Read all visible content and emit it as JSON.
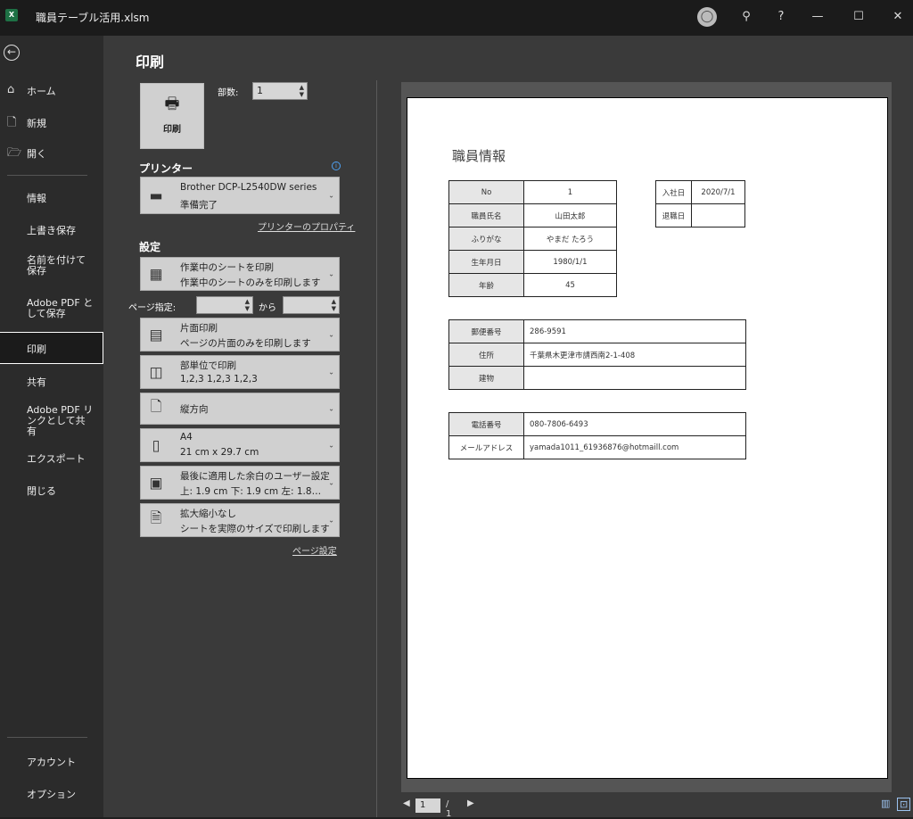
{
  "window": {
    "title": "職員テーブル活用.xlsm",
    "app_icon": "X",
    "buttons": {
      "help": "?",
      "minimize": "—",
      "maximize": "☐",
      "close": "✕"
    }
  },
  "sidebar": {
    "items": [
      {
        "label": "ホーム",
        "icon": "home-icon"
      },
      {
        "label": "新規",
        "icon": "new-document-icon"
      },
      {
        "label": "開く",
        "icon": "open-folder-icon"
      },
      {
        "label": "情報"
      },
      {
        "label": "上書き保存"
      },
      {
        "label": "名前を付けて保存"
      },
      {
        "label": "Adobe PDF として保存"
      },
      {
        "label": "印刷",
        "selected": true
      },
      {
        "label": "共有"
      },
      {
        "label": "Adobe PDF リンクとして共有"
      },
      {
        "label": "エクスポート"
      },
      {
        "label": "閉じる"
      },
      {
        "label": "アカウント"
      },
      {
        "label": "オプション"
      }
    ]
  },
  "print": {
    "heading": "印刷",
    "print_button": "印刷",
    "copies_label": "部数:",
    "copies_value": "1",
    "printer_section": "プリンター",
    "printer_name": "Brother DCP-L2540DW series",
    "printer_status": "準備完了",
    "printer_properties": "プリンターのプロパティ",
    "settings_section": "設定",
    "what_to_print": {
      "line1": "作業中のシートを印刷",
      "line2": "作業中のシートのみを印刷します"
    },
    "pages_label": "ページ指定:",
    "pages_to": "から",
    "sides": {
      "line1": "片面印刷",
      "line2": "ページの片面のみを印刷します"
    },
    "collate": {
      "line1": "部単位で印刷",
      "line2": "1,2,3    1,2,3    1,2,3"
    },
    "orientation": {
      "line1": "縦方向"
    },
    "paper": {
      "line1": "A4",
      "line2": "21 cm x 29.7 cm"
    },
    "margins": {
      "line1": "最後に適用した余白のユーザー設定",
      "line2": "上: 1.9 cm 下: 1.9 cm 左: 1.8…"
    },
    "scaling": {
      "line1": "拡大縮小なし",
      "line2": "シートを実際のサイズで印刷します"
    },
    "page_setup": "ページ設定"
  },
  "preview": {
    "sheet_title": "職員情報",
    "basic": [
      {
        "label": "No",
        "value": "1"
      },
      {
        "label": "職員氏名",
        "value": "山田太郎"
      },
      {
        "label": "ふりがな",
        "value": "やまだ たろう"
      },
      {
        "label": "生年月日",
        "value": "1980/1/1"
      },
      {
        "label": "年齢",
        "value": "45"
      }
    ],
    "dates": [
      {
        "label": "入社日",
        "value": "2020/7/1"
      },
      {
        "label": "退職日",
        "value": ""
      }
    ],
    "address": [
      {
        "label": "郵便番号",
        "value": "286-9591"
      },
      {
        "label": "住所",
        "value": "千葉県木更津市請西南2-1-408"
      },
      {
        "label": "建物",
        "value": ""
      }
    ],
    "contact": [
      {
        "label": "電話番号",
        "value": "080-7806-6493"
      },
      {
        "label": "メールアドレス",
        "value": "yamada1011_61936876@hotmaill.com"
      }
    ]
  },
  "pager": {
    "current": "1",
    "total": "/ 1"
  }
}
